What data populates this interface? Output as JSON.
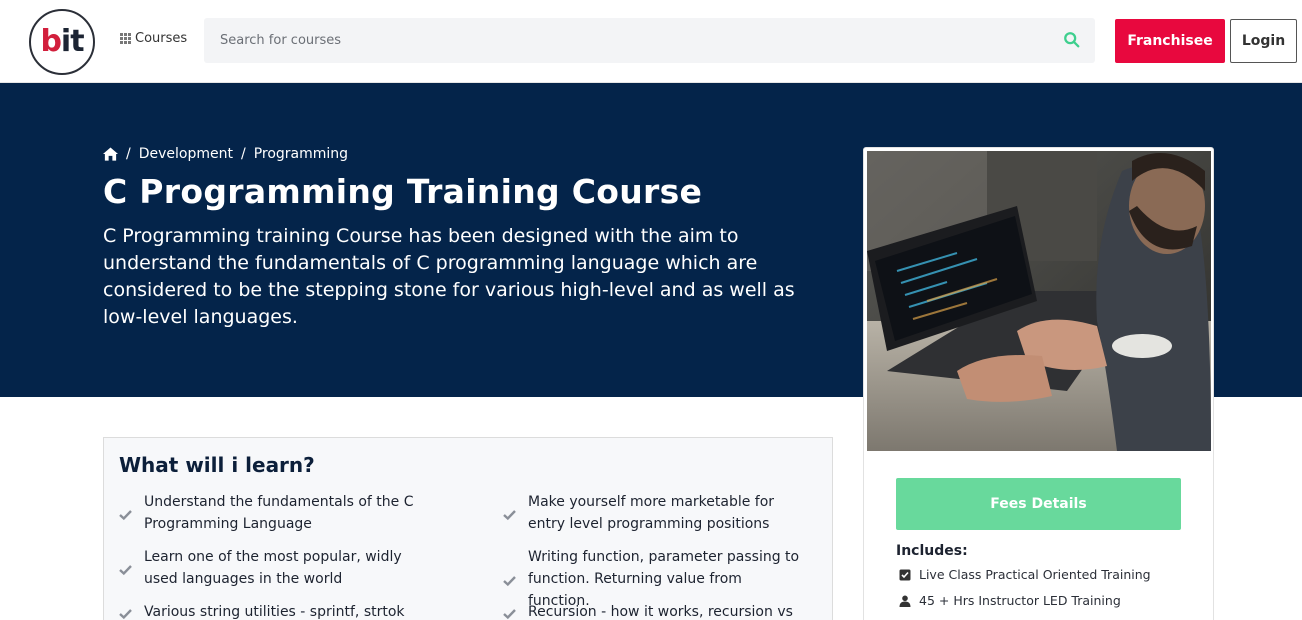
{
  "header": {
    "logo": {
      "b": "b",
      "i": "i",
      "t": "t"
    },
    "courses_label": "Courses",
    "search_placeholder": "Search for courses",
    "franchisee_label": "Franchisee",
    "login_label": "Login",
    "colors": {
      "brand_red": "#e8083e",
      "search_accent": "#3ecf8e"
    }
  },
  "hero": {
    "breadcrumb": [
      "Development",
      "Programming"
    ],
    "breadcrumb_separator": "/",
    "title": "C Programming Training Course",
    "description": "C Programming training Course has been designed with the aim to understand the fundamentals of C programming language which are considered to be the stepping stone for various high-level and as well as low-level languages.",
    "background_color": "#04244a"
  },
  "card": {
    "fees_label": "Fees Details",
    "includes_title": "Includes:",
    "includes": [
      {
        "icon": "checkbox-icon",
        "label": "Live Class Practical Oriented Training"
      },
      {
        "icon": "user-icon",
        "label": "45 + Hrs Instructor LED Training"
      }
    ],
    "fees_color": "#68d99c"
  },
  "learn": {
    "title": "What will i learn?",
    "items": [
      "Understand the fundamentals of the C Programming Language",
      "Make yourself more marketable for entry level programming positions",
      "Learn one of the most popular, widly used languages in the world",
      "Writing function, parameter passing to function. Returning value from function.",
      "Various string utilities - sprintf, strtok",
      "Recursion - how it works, recursion vs"
    ]
  }
}
